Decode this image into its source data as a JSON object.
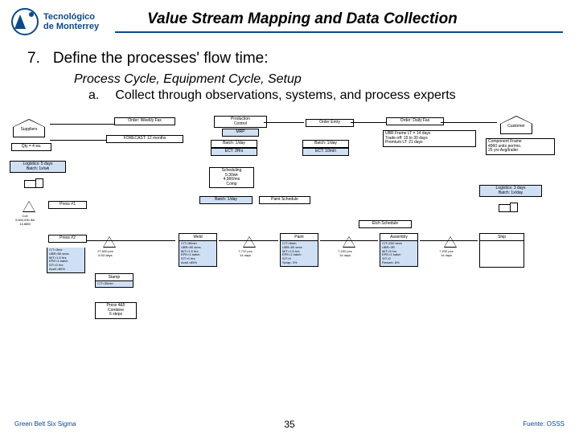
{
  "logo": {
    "line1": "Tecnológico",
    "line2": "de Monterrey"
  },
  "title": "Value Stream Mapping and Data Collection",
  "item": {
    "num": "7.",
    "text": "Define the processes' flow time:",
    "sub_italic": "Process Cycle, Equipment Cycle, Setup",
    "sub_a_letter": "a.",
    "sub_a_text": "Collect through observations, systems, and process experts"
  },
  "diagram": {
    "suppliers": "Suppliers",
    "suppliers_sub": "Qty = 4 ea.",
    "order_weekly": "Order: Weekly Fax",
    "forecast": "FORECAST: 12 months",
    "prod_control": "Production\nControl",
    "mrp": "MRP",
    "order_entry": "Order Entry",
    "batch_1day": "Batch: 1/day",
    "ect_3hrs": "ECT: 3Hrs",
    "batch_1day2": "Batch: 1/day",
    "ect_10min": "ECT: 10min",
    "order_daily": "Order: Daily Fax",
    "customer": "Customer",
    "customer_sub": "UBR Frame LT = 14 days\nTrade-off: 15 to 30 days\nPremium LT: 21 days",
    "comp_frame": "Component Frame\n4960 units per/mo.\n25 yrs Avg/trailer",
    "logistics_in": "Logistics: 5 days\nBatch: 1x/wk",
    "scheduling": "Scheduling\n5:30wk\n4,960/mo\nComp",
    "batch_1day3": "Batch: 1/day",
    "paint_sched": "Paint Schedule",
    "etch": "Etch Schedule",
    "logistics_out": "Logistics: 3 days\nBatch: 1x/day",
    "press1": "Press #1",
    "press2": "Press #2",
    "stamp": "Stamp",
    "press45": "Press 4&5\nCombine\n6 steps",
    "weld": "Weld",
    "paint": "Paint",
    "assembly": "Assembly",
    "ship": "Ship",
    "tri_coil": "Coil\n9,600,000 lbs\n14.88M",
    "tri_1": "27,600 pcs\n5.53 days",
    "tri_2": "7,712 pcs\n14 days",
    "tri_3": "7,232 pcs\n14 days",
    "tri_4": "7,232 pcs\n14 days",
    "proc_metrics": "C/T=3ms\nUBR=50 secs\nM/T=1.5 hrs\nEPE=1 batch\nS/T=0 hrs\nAvail.=85%",
    "stamp_metrics": "C/T=30min",
    "weld_metrics": "C/T=30min\nUBR=50 secs\nM/T=1.5 hrs\nEPE=1 batch\nS/T=0 hrs\nAvail.=85%",
    "paint_metrics": "C/T=5min\nUBR=50 secs\nM/T=1.5 hrs\nEPE=1 batch\nS/T=0\nScrap: 3%",
    "assy_metrics": "C/T=200 secs\nUBR=3R\nM/T=5 hrs\nEPE=1 batch\nS/T=0\nRework: 8%"
  },
  "footer": {
    "left": "Green Belt Six Sigma",
    "center": "35",
    "right": "Fuente: OSSS"
  }
}
